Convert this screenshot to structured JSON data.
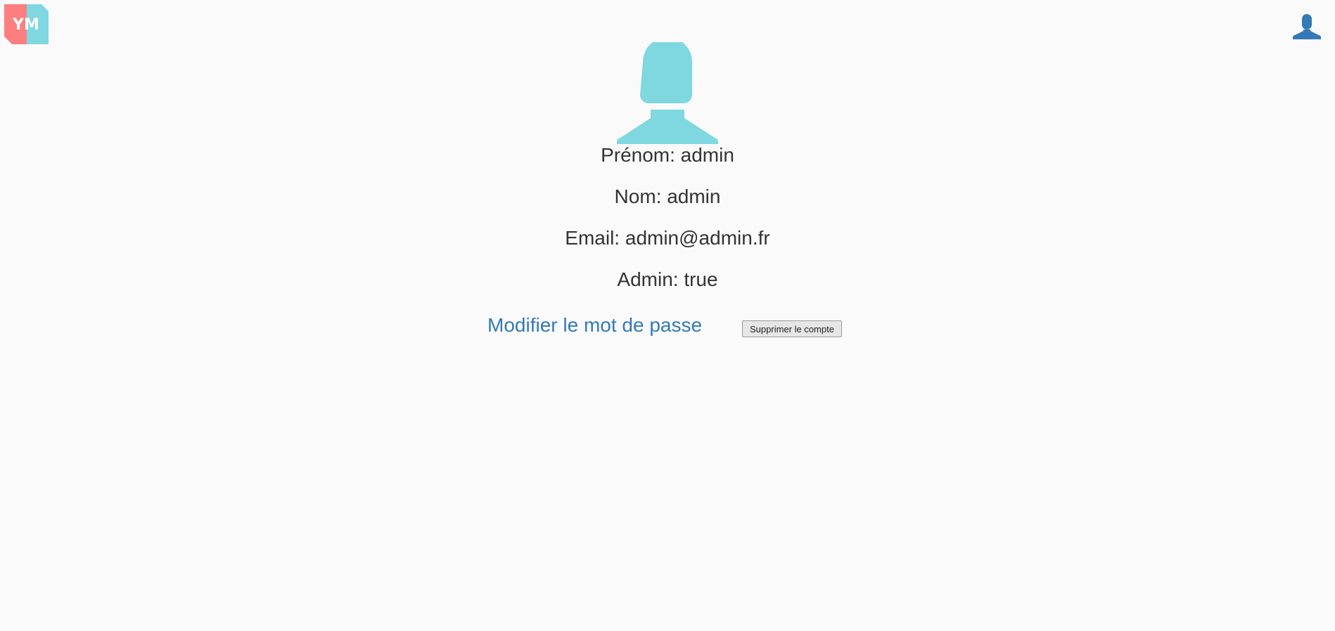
{
  "header": {
    "logo_text": "YM",
    "logo_colors": {
      "left": "#fd7f7f",
      "right": "#7fd8e0"
    },
    "account_icon": "user-icon",
    "account_icon_color": "#337ab7"
  },
  "profile": {
    "avatar_icon": "user-avatar-icon",
    "avatar_color": "#7fd8e0",
    "fields": [
      {
        "label": "Prénom",
        "value": "admin",
        "text": "Prénom: admin"
      },
      {
        "label": "Nom",
        "value": "admin",
        "text": "Nom: admin"
      },
      {
        "label": "Email",
        "value": "admin@admin.fr",
        "text": "Email: admin@admin.fr"
      },
      {
        "label": "Admin",
        "value": "true",
        "text": "Admin: true"
      }
    ]
  },
  "actions": {
    "change_password_label": "Modifier le mot de passe",
    "delete_account_label": "Supprimer le compte",
    "link_color": "#337ab7"
  }
}
